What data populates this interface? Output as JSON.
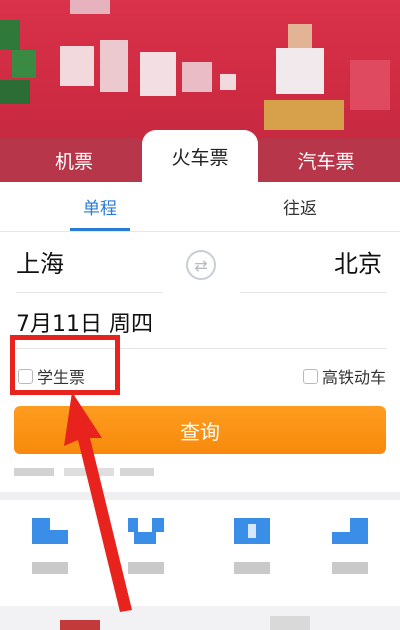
{
  "tabs": {
    "flight": "机票",
    "train": "火车票",
    "bus": "汽车票",
    "active": "train"
  },
  "trip_type": {
    "one_way": "单程",
    "round_trip": "往返",
    "active": "one_way"
  },
  "route": {
    "from": "上海",
    "to": "北京",
    "swap_icon": "swap-icon"
  },
  "date": {
    "text": "7月11日 周四"
  },
  "options": {
    "student_ticket": "学生票",
    "high_speed_only": "高铁动车"
  },
  "query_button": "查询",
  "colors": {
    "accent_blue": "#2a7ad8",
    "query_orange": "#f78a0c",
    "banner_red": "#d9324a",
    "highlight_red": "#e8231d"
  }
}
